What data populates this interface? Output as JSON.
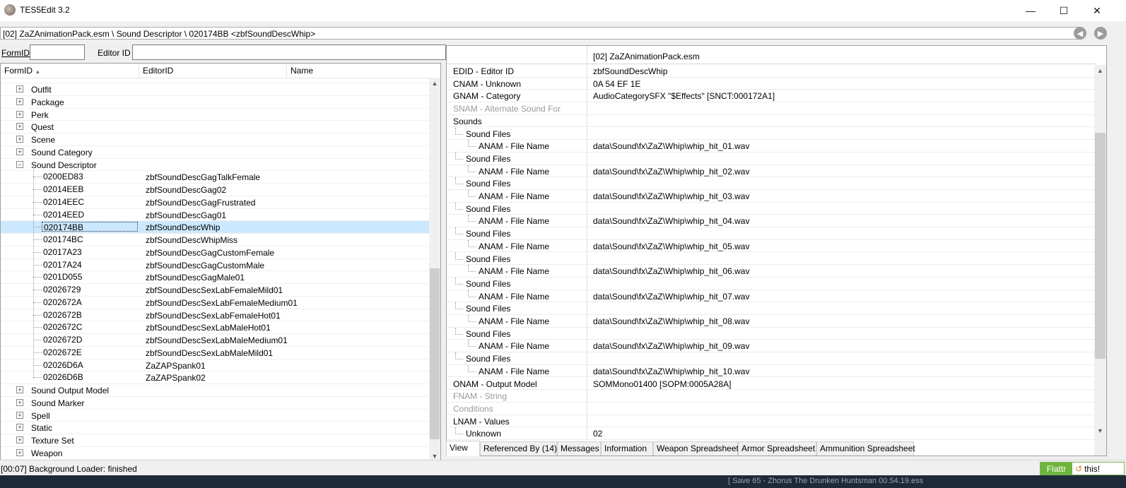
{
  "window": {
    "title": "TES5Edit 3.2",
    "minimize": "—",
    "maximize": "☐",
    "close": "✕"
  },
  "pathbar": {
    "path": "[02] ZaZAnimationPack.esm \\ Sound Descriptor \\ 020174BB <zbfSoundDescWhip>"
  },
  "filters": {
    "formid_label": "FormID",
    "formid_value": "",
    "editorid_label": "Editor ID",
    "editorid_value": ""
  },
  "tree": {
    "headers": [
      "FormID",
      "EditorID",
      "Name"
    ],
    "categories_top": [
      "Outfit",
      "Package",
      "Perk",
      "Quest",
      "Scene",
      "Sound Category",
      "Sound Descriptor"
    ],
    "records": [
      {
        "formid": "0200ED83",
        "editorid": "zbfSoundDescGagTalkFemale"
      },
      {
        "formid": "02014EEB",
        "editorid": "zbfSoundDescGag02"
      },
      {
        "formid": "02014EEC",
        "editorid": "zbfSoundDescGagFrustrated"
      },
      {
        "formid": "02014EED",
        "editorid": "zbfSoundDescGag01"
      },
      {
        "formid": "020174BB",
        "editorid": "zbfSoundDescWhip"
      },
      {
        "formid": "020174BC",
        "editorid": "zbfSoundDescWhipMiss"
      },
      {
        "formid": "02017A23",
        "editorid": "zbfSoundDescGagCustomFemale"
      },
      {
        "formid": "02017A24",
        "editorid": "zbfSoundDescGagCustomMale"
      },
      {
        "formid": "0201D055",
        "editorid": "zbfSoundDescGagMale01"
      },
      {
        "formid": "02026729",
        "editorid": "zbfSoundDescSexLabFemaleMild01"
      },
      {
        "formid": "0202672A",
        "editorid": "zbfSoundDescSexLabFemaleMedium01"
      },
      {
        "formid": "0202672B",
        "editorid": "zbfSoundDescSexLabFemaleHot01"
      },
      {
        "formid": "0202672C",
        "editorid": "zbfSoundDescSexLabMaleHot01"
      },
      {
        "formid": "0202672D",
        "editorid": "zbfSoundDescSexLabMaleMedium01"
      },
      {
        "formid": "0202672E",
        "editorid": "zbfSoundDescSexLabMaleMild01"
      },
      {
        "formid": "02026D6A",
        "editorid": "ZaZAPSpank01"
      },
      {
        "formid": "02026D6B",
        "editorid": "ZaZAPSpank02"
      }
    ],
    "selected_formid": "020174BB",
    "categories_bottom": [
      "Sound Output Model",
      "Sound Marker",
      "Spell",
      "Static",
      "Texture Set",
      "Weapon"
    ]
  },
  "record_view": {
    "plugin_header": "[02] ZaZAnimationPack.esm",
    "rows": [
      {
        "label": "EDID - Editor ID",
        "value": "zbfSoundDescWhip",
        "indent": 0,
        "gray": false
      },
      {
        "label": "CNAM - Unknown",
        "value": "0A 54 EF 1E",
        "indent": 0,
        "gray": false
      },
      {
        "label": "GNAM - Category",
        "value": "AudioCategorySFX \"$Effects\" [SNCT:000172A1]",
        "indent": 0,
        "gray": false
      },
      {
        "label": "SNAM - Alternate Sound For",
        "value": "",
        "indent": 0,
        "gray": true
      },
      {
        "label": "Sounds",
        "value": "",
        "indent": 0,
        "gray": false
      },
      {
        "label": "Sound Files",
        "value": "",
        "indent": 1,
        "gray": false
      },
      {
        "label": "ANAM - File Name",
        "value": "data\\Sound\\fx\\ZaZ\\Whip\\whip_hit_01.wav",
        "indent": 2,
        "gray": false
      },
      {
        "label": "Sound Files",
        "value": "",
        "indent": 1,
        "gray": false
      },
      {
        "label": "ANAM - File Name",
        "value": "data\\Sound\\fx\\ZaZ\\Whip\\whip_hit_02.wav",
        "indent": 2,
        "gray": false
      },
      {
        "label": "Sound Files",
        "value": "",
        "indent": 1,
        "gray": false
      },
      {
        "label": "ANAM - File Name",
        "value": "data\\Sound\\fx\\ZaZ\\Whip\\whip_hit_03.wav",
        "indent": 2,
        "gray": false
      },
      {
        "label": "Sound Files",
        "value": "",
        "indent": 1,
        "gray": false
      },
      {
        "label": "ANAM - File Name",
        "value": "data\\Sound\\fx\\ZaZ\\Whip\\whip_hit_04.wav",
        "indent": 2,
        "gray": false
      },
      {
        "label": "Sound Files",
        "value": "",
        "indent": 1,
        "gray": false
      },
      {
        "label": "ANAM - File Name",
        "value": "data\\Sound\\fx\\ZaZ\\Whip\\whip_hit_05.wav",
        "indent": 2,
        "gray": false
      },
      {
        "label": "Sound Files",
        "value": "",
        "indent": 1,
        "gray": false
      },
      {
        "label": "ANAM - File Name",
        "value": "data\\Sound\\fx\\ZaZ\\Whip\\whip_hit_06.wav",
        "indent": 2,
        "gray": false
      },
      {
        "label": "Sound Files",
        "value": "",
        "indent": 1,
        "gray": false
      },
      {
        "label": "ANAM - File Name",
        "value": "data\\Sound\\fx\\ZaZ\\Whip\\whip_hit_07.wav",
        "indent": 2,
        "gray": false
      },
      {
        "label": "Sound Files",
        "value": "",
        "indent": 1,
        "gray": false
      },
      {
        "label": "ANAM - File Name",
        "value": "data\\Sound\\fx\\ZaZ\\Whip\\whip_hit_08.wav",
        "indent": 2,
        "gray": false
      },
      {
        "label": "Sound Files",
        "value": "",
        "indent": 1,
        "gray": false
      },
      {
        "label": "ANAM - File Name",
        "value": "data\\Sound\\fx\\ZaZ\\Whip\\whip_hit_09.wav",
        "indent": 2,
        "gray": false
      },
      {
        "label": "Sound Files",
        "value": "",
        "indent": 1,
        "gray": false
      },
      {
        "label": "ANAM - File Name",
        "value": "data\\Sound\\fx\\ZaZ\\Whip\\whip_hit_10.wav",
        "indent": 2,
        "gray": false
      },
      {
        "label": "ONAM - Output Model",
        "value": "SOMMono01400 [SOPM:0005A28A]",
        "indent": 0,
        "gray": false
      },
      {
        "label": "FNAM - String",
        "value": "",
        "indent": 0,
        "gray": true
      },
      {
        "label": "Conditions",
        "value": "",
        "indent": 0,
        "gray": true
      },
      {
        "label": "LNAM - Values",
        "value": "",
        "indent": 0,
        "gray": false
      },
      {
        "label": "Unknown",
        "value": "02",
        "indent": 1,
        "gray": false
      }
    ]
  },
  "tabs": [
    {
      "label": "View",
      "active": true
    },
    {
      "label": "Referenced By (14)",
      "active": false
    },
    {
      "label": "Messages",
      "active": false
    },
    {
      "label": "Information",
      "active": false
    },
    {
      "label": "Weapon Spreadsheet",
      "active": false
    },
    {
      "label": "Armor Spreadsheet",
      "active": false
    },
    {
      "label": "Ammunition Spreadsheet",
      "active": false
    }
  ],
  "status": {
    "text": "[00:07] Background Loader: finished"
  },
  "flattr": {
    "left": "Flattr",
    "right": "this!"
  },
  "taskbar": {
    "text": "[ Save 65 - Zhorus  The Drunken Huntsman  00.54.19.ess"
  }
}
